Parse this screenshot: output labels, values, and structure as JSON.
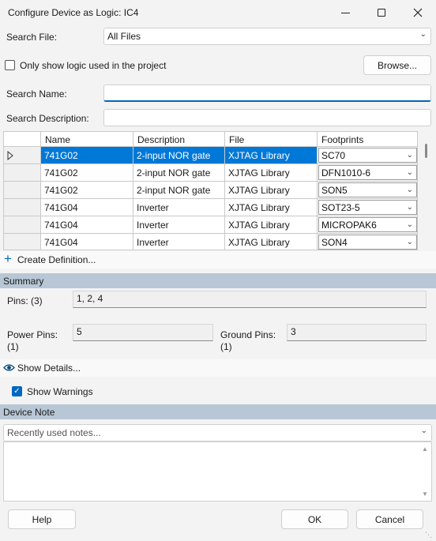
{
  "window": {
    "title": "Configure Device as Logic: IC4"
  },
  "search_file": {
    "label": "Search File:",
    "value": "All Files"
  },
  "only_show": {
    "label": "Only show logic used in the project"
  },
  "browse_button": "Browse...",
  "search_name": {
    "label": "Search Name:",
    "value": ""
  },
  "search_description": {
    "label": "Search Description:",
    "value": ""
  },
  "grid": {
    "columns": [
      "Name",
      "Description",
      "File",
      "Footprints"
    ],
    "rows": [
      {
        "name": "741G02",
        "description": "2-input NOR gate",
        "file": "XJTAG Library",
        "footprint": "SC70",
        "selected": true
      },
      {
        "name": "741G02",
        "description": "2-input NOR gate",
        "file": "XJTAG Library",
        "footprint": "DFN1010-6"
      },
      {
        "name": "741G02",
        "description": "2-input NOR gate",
        "file": "XJTAG Library",
        "footprint": "SON5"
      },
      {
        "name": "741G04",
        "description": "Inverter",
        "file": "XJTAG Library",
        "footprint": "SOT23-5"
      },
      {
        "name": "741G04",
        "description": "Inverter",
        "file": "XJTAG Library",
        "footprint": "MICROPAK6"
      },
      {
        "name": "741G04",
        "description": "Inverter",
        "file": "XJTAG Library",
        "footprint": "SON4"
      }
    ]
  },
  "create_definition": "Create Definition...",
  "summary": {
    "heading": "Summary",
    "pins_label": "Pins: (3)",
    "pins_value": "1, 2, 4",
    "power_label_1": "Power Pins:",
    "power_label_2": "(1)",
    "power_value": "5",
    "ground_label_1": "Ground Pins:",
    "ground_label_2": "(1)",
    "ground_value": "3"
  },
  "show_details": "Show Details...",
  "show_warnings": {
    "label": "Show Warnings",
    "checked": true
  },
  "device_note": {
    "heading": "Device Note",
    "placeholder": "Recently used notes...",
    "text": ""
  },
  "buttons": {
    "help": "Help",
    "ok": "OK",
    "cancel": "Cancel"
  },
  "colors": {
    "accent": "#0078d7",
    "section": "#b8c7d6"
  }
}
